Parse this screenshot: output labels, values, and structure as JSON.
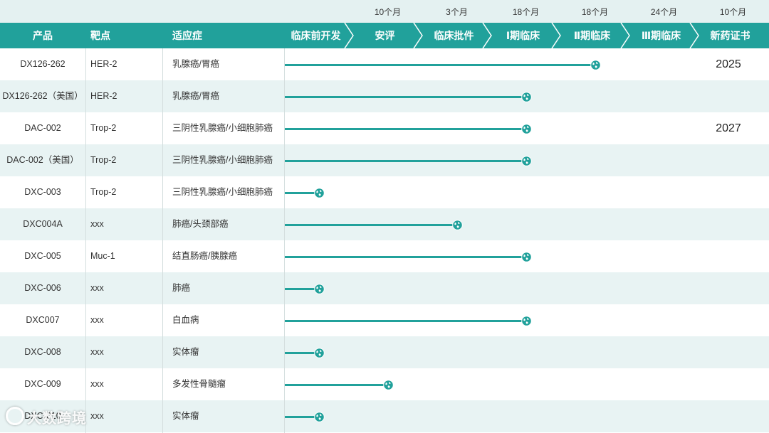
{
  "colors": {
    "accent": "#21a19b",
    "duration_bg": "#e4f1f1",
    "alt_row_bg": "#e8f3f3"
  },
  "header": {
    "product": "产品",
    "target": "靶点",
    "indication": "适应症",
    "phases": [
      "临床前开发",
      "安评",
      "临床批件",
      "Ⅰ期临床",
      "Ⅱ期临床",
      "Ⅲ期临床",
      "新药证书"
    ],
    "durations": [
      "",
      "10个月",
      "3个月",
      "18个月",
      "18个月",
      "24个月",
      "10个月"
    ]
  },
  "chart_data": {
    "type": "bar",
    "orientation": "horizontal",
    "value_unit": "phase progress (0 = 临床前开发 start, 7 = 新药证书 end)",
    "categories": [
      "临床前开发",
      "安评",
      "临床批件",
      "Ⅰ期临床",
      "Ⅱ期临床",
      "Ⅲ期临床",
      "新药证书"
    ],
    "rows": [
      {
        "product": "DX126-262",
        "target": "HER-2",
        "indication": "乳腺癌/胃癌",
        "progress": 4.5,
        "approval": "2025"
      },
      {
        "product": "DX126-262（美国）",
        "target": "HER-2",
        "indication": "乳腺癌/胃癌",
        "progress": 3.5,
        "approval": ""
      },
      {
        "product": "DAC-002",
        "target": "Trop-2",
        "indication": "三阴性乳腺癌/小细胞肺癌",
        "progress": 3.5,
        "approval": "2027"
      },
      {
        "product": "DAC-002（美国）",
        "target": "Trop-2",
        "indication": "三阴性乳腺癌/小细胞肺癌",
        "progress": 3.5,
        "approval": ""
      },
      {
        "product": "DXC-003",
        "target": "Trop-2",
        "indication": "三阴性乳腺癌/小细胞肺癌",
        "progress": 0.5,
        "approval": ""
      },
      {
        "product": "DXC004A",
        "target": "xxx",
        "indication": "肺癌/头颈部癌",
        "progress": 2.5,
        "approval": ""
      },
      {
        "product": "DXC-005",
        "target": "Muc-1",
        "indication": "结直肠癌/胰腺癌",
        "progress": 3.5,
        "approval": ""
      },
      {
        "product": "DXC-006",
        "target": "xxx",
        "indication": "肺癌",
        "progress": 0.5,
        "approval": ""
      },
      {
        "product": "DXC007",
        "target": "xxx",
        "indication": "白血病",
        "progress": 3.5,
        "approval": ""
      },
      {
        "product": "DXC-008",
        "target": "xxx",
        "indication": "实体瘤",
        "progress": 0.5,
        "approval": ""
      },
      {
        "product": "DXC-009",
        "target": "xxx",
        "indication": "多发性骨髓瘤",
        "progress": 1.5,
        "approval": ""
      },
      {
        "product": "DXC-010",
        "target": "xxx",
        "indication": "实体瘤",
        "progress": 0.5,
        "approval": ""
      }
    ]
  },
  "watermark": "大数跨境",
  "icons": {
    "marker": "globe-icon",
    "watermark": "logo-icon"
  }
}
